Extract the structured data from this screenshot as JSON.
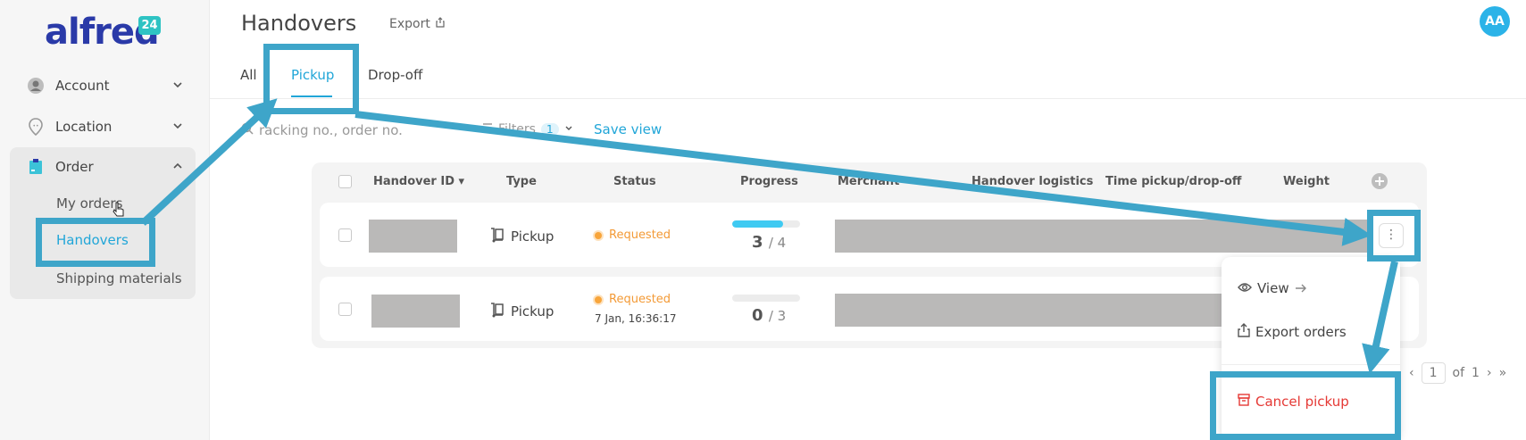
{
  "app": {
    "logo_text": "alfred",
    "logo_badge": "24"
  },
  "sidebar": {
    "items": [
      {
        "label": "Account"
      },
      {
        "label": "Location"
      },
      {
        "label": "Order"
      }
    ],
    "order_sub": [
      {
        "label": "My orders"
      },
      {
        "label": "Handovers"
      },
      {
        "label": "Shipping materials"
      }
    ]
  },
  "header": {
    "title": "Handovers",
    "export_label": "Export",
    "avatar_initials": "AA"
  },
  "tabs": [
    {
      "label": "All"
    },
    {
      "label": "Pickup"
    },
    {
      "label": "Drop-off"
    }
  ],
  "toolbar": {
    "search_placeholder": "racking no., order no.",
    "filters_label": "Filters",
    "filters_count": "1",
    "save_view_label": "Save view"
  },
  "table": {
    "columns": [
      "Handover ID",
      "Type",
      "Status",
      "Progress",
      "Merchant",
      "Handover logistics",
      "Time pickup/drop-off",
      "Weight"
    ],
    "rows": [
      {
        "type": "Pickup",
        "status": "Requested",
        "status_date": "",
        "progress_done": "3",
        "progress_total": "4"
      },
      {
        "type": "Pickup",
        "status": "Requested",
        "status_date": "7 Jan, 16:36:17",
        "progress_done": "0",
        "progress_total": "3"
      }
    ]
  },
  "menu": {
    "view_label": "View",
    "export_label": "Export orders",
    "cancel_label": "Cancel pickup"
  },
  "pagination": {
    "page": "1",
    "of_label": "of",
    "total": "1"
  },
  "colors": {
    "accent": "#21a6d8",
    "annotation": "#3ea5c9",
    "status": "#f39a36",
    "danger": "#e53935"
  }
}
